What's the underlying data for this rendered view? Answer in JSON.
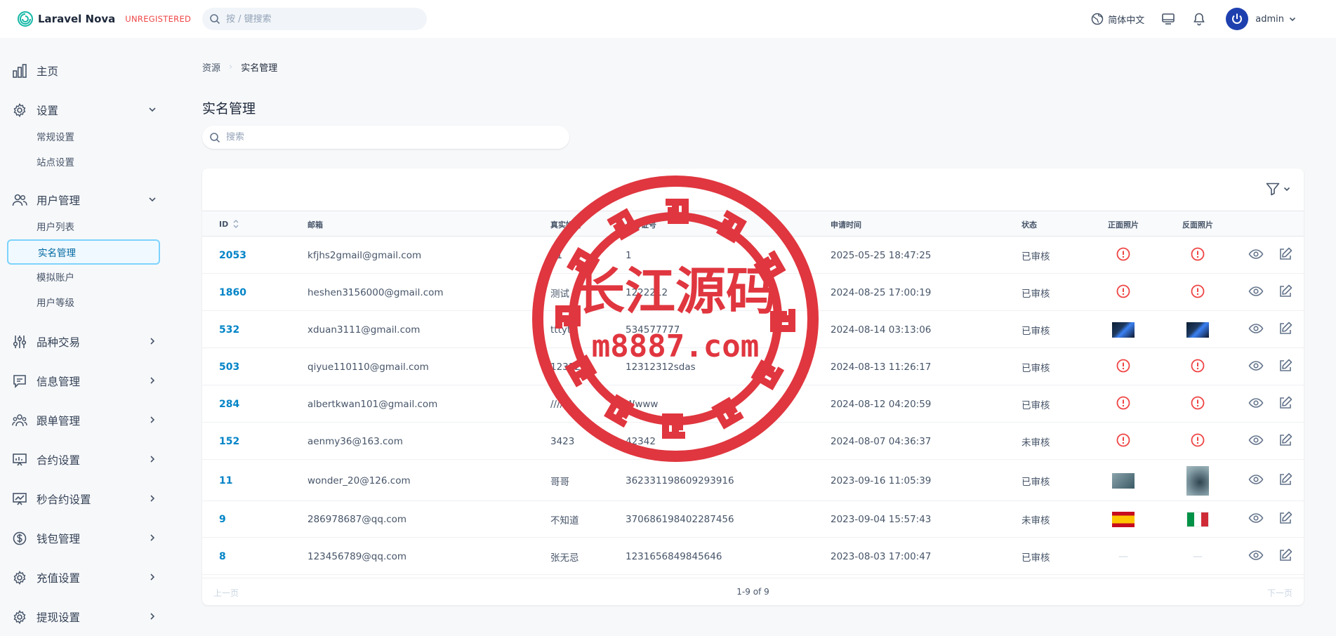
{
  "app": {
    "brand": "Laravel Nova",
    "unregistered": "UNREGISTERED"
  },
  "global_search": {
    "placeholder": "按 / 键搜索"
  },
  "topbar": {
    "language": "简体中文",
    "user": "admin"
  },
  "sidebar": {
    "home": "主页",
    "settings": {
      "label": "设置",
      "items": [
        "常规设置",
        "站点设置"
      ]
    },
    "users": {
      "label": "用户管理",
      "items": [
        "用户列表",
        "实名管理",
        "模拟账户",
        "用户等级"
      ]
    },
    "groups": [
      "品种交易",
      "信息管理",
      "跟单管理",
      "合约设置",
      "秒合约设置",
      "钱包管理",
      "充值设置",
      "提现设置"
    ]
  },
  "breadcrumb": {
    "parent": "资源",
    "current": "实名管理"
  },
  "page": {
    "title": "实名管理",
    "search_placeholder": "搜索"
  },
  "table": {
    "columns": {
      "id": "ID",
      "email": "邮箱",
      "real_name": "真实姓名",
      "id_number": "身份证号",
      "applied_at": "申请时间",
      "status": "状态",
      "front_photo": "正面照片",
      "back_photo": "反面照片"
    },
    "rows": [
      {
        "id": "2053",
        "email": "kfjhs2gmail@gmail.com",
        "name": "11",
        "id_number": "1",
        "time": "2025-05-25 18:47:25",
        "status": "已审核",
        "front": "missing",
        "back": "missing"
      },
      {
        "id": "1860",
        "email": "heshen3156000@gmail.com",
        "name": "测试",
        "id_number": "1222212",
        "time": "2024-08-25 17:00:19",
        "status": "已审核",
        "front": "missing",
        "back": "missing"
      },
      {
        "id": "532",
        "email": "xduan3111@gmail.com",
        "name": "tttyt",
        "id_number": "534577777",
        "time": "2024-08-14 03:13:06",
        "status": "已审核",
        "front": "blue-photo",
        "back": "blue-photo"
      },
      {
        "id": "503",
        "email": "qiyue110110@gmail.com",
        "name": "12312",
        "id_number": "12312312sdas",
        "time": "2024-08-13 11:26:17",
        "status": "已审核",
        "front": "missing",
        "back": "missing"
      },
      {
        "id": "284",
        "email": "albertkwan101@gmail.com",
        "name": "////",
        "id_number": "Wwww",
        "time": "2024-08-12 04:20:59",
        "status": "已审核",
        "front": "missing",
        "back": "missing"
      },
      {
        "id": "152",
        "email": "aenmy36@163.com",
        "name": "3423",
        "id_number": "42342",
        "time": "2024-08-07 04:36:37",
        "status": "未审核",
        "front": "missing",
        "back": "missing"
      },
      {
        "id": "11",
        "email": "wonder_20@126.com",
        "name": "哥哥",
        "id_number": "362331198609293916",
        "time": "2023-09-16 11:05:39",
        "status": "已审核",
        "front": "gray-photo",
        "back": "gray-photo-tall"
      },
      {
        "id": "9",
        "email": "286978687@qq.com",
        "name": "不知道",
        "id_number": "370686198402287456",
        "time": "2023-09-04 15:57:43",
        "status": "未审核",
        "front": "flag-spain",
        "back": "flag-italy"
      },
      {
        "id": "8",
        "email": "123456789@qq.com",
        "name": "张无忌",
        "id_number": "1231656849845646",
        "time": "2023-08-03 17:00:47",
        "status": "已审核",
        "front": "none",
        "back": "none"
      }
    ],
    "empty_mark": "—"
  },
  "pagination": {
    "prev": "上一页",
    "info": "1-9 of 9",
    "next": "下一页"
  },
  "watermark": {
    "title": "长江源码",
    "url": "m8887.com",
    "color": "#e0363f"
  },
  "colors": {
    "accent": "#0284c7",
    "danger": "#ef4444",
    "brand_teal": "#0ea5e9"
  }
}
